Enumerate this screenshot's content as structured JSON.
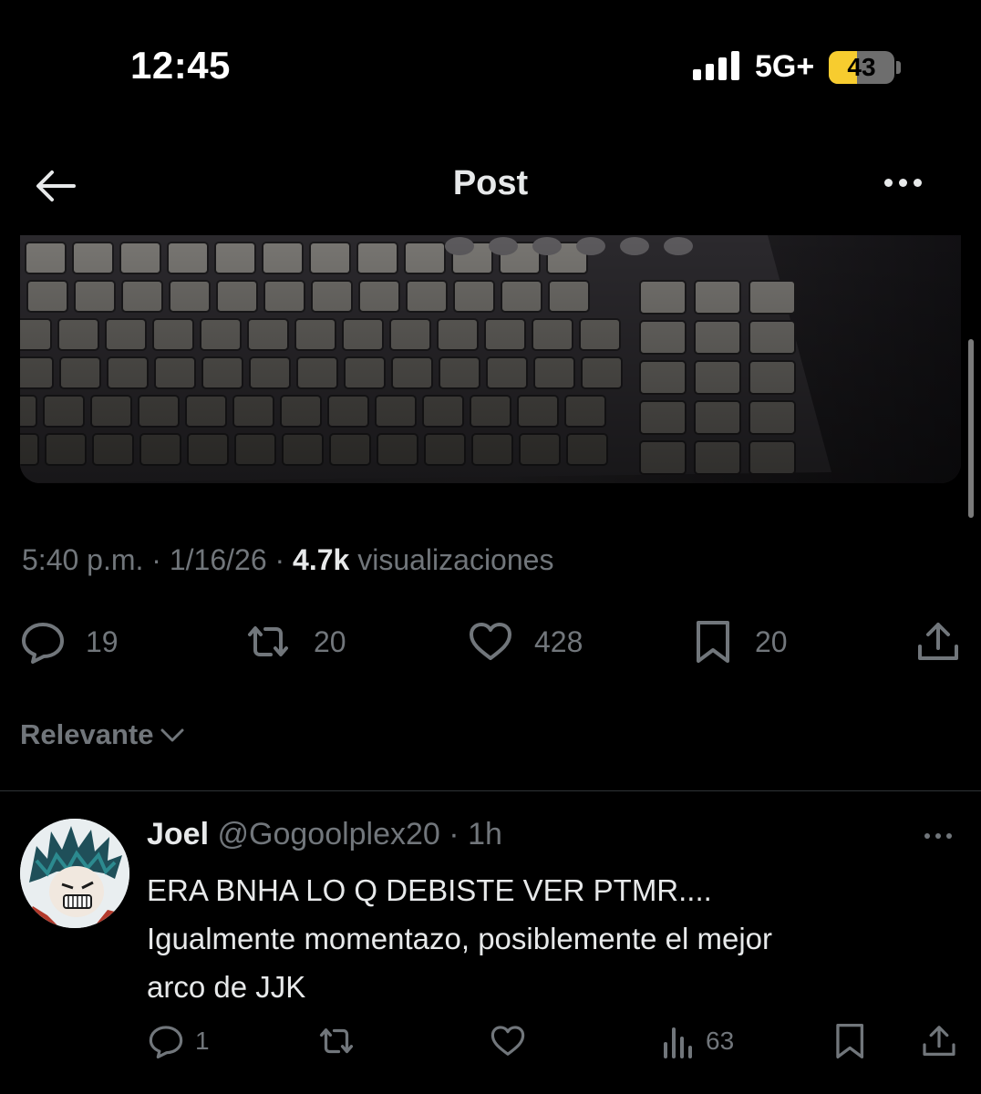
{
  "status_bar": {
    "time": "12:45",
    "network": "5G+",
    "battery": "43",
    "battery_level": 0.43,
    "signal_bars": 4
  },
  "header": {
    "back_icon": "arrow-left-icon",
    "title": "Post",
    "more_icon": "more-horizontal-icon"
  },
  "post": {
    "media_alt": "keyboard photo",
    "time": "5:40 p.m.",
    "date": "1/16/26",
    "views": "4.7k",
    "views_label": "visualizaciones",
    "separator": "·",
    "actions": {
      "replies": "19",
      "reposts": "20",
      "likes": "428",
      "bookmarks": "20"
    }
  },
  "sort": {
    "label": "Relevante",
    "icon": "chevron-down-icon"
  },
  "reply": {
    "name": "Joel",
    "handle": "@Gogoolplex20",
    "time": "1h",
    "text_line1": "ERA BNHA LO Q DEBISTE VER PTMR....",
    "text_line2": "Igualmente momentazo, posiblemente el mejor",
    "text_line3": "arco de JJK",
    "actions": {
      "replies": "1",
      "views": "63"
    }
  },
  "colors": {
    "background": "#000000",
    "text_primary": "#e7e9ea",
    "text_secondary": "#71767b",
    "divider": "#2f3336",
    "battery": "#f7cc2f"
  }
}
